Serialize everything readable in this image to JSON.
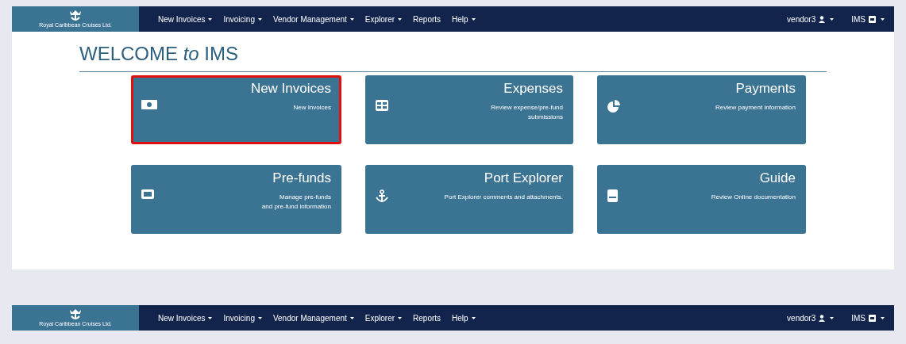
{
  "navbars": [
    {
      "logo_text": "Royal Caribbean Cruises Ltd.",
      "menu": [
        {
          "label": "New Invoices",
          "dropdown": true
        },
        {
          "label": "Invoicing",
          "dropdown": true
        },
        {
          "label": "Vendor Management",
          "dropdown": true
        },
        {
          "label": "Explorer",
          "dropdown": true
        },
        {
          "label": "Reports",
          "dropdown": false
        },
        {
          "label": "Help",
          "dropdown": true
        }
      ],
      "user": "vendor3",
      "app": "IMS"
    },
    {
      "logo_text": "Royal Caribbean Cruises Ltd.",
      "menu": [
        {
          "label": "New Invoices",
          "dropdown": true
        },
        {
          "label": "Invoicing",
          "dropdown": true
        },
        {
          "label": "Vendor Management",
          "dropdown": true
        },
        {
          "label": "Explorer",
          "dropdown": true
        },
        {
          "label": "Reports",
          "dropdown": false
        },
        {
          "label": "Help",
          "dropdown": true
        }
      ],
      "user": "vendor3",
      "app": "IMS"
    }
  ],
  "heading": "WELCOME *to* IMS",
  "tiles": [
    {
      "title": "New Invoices",
      "description": [
        "New Invoices"
      ],
      "selected": true
    },
    {
      "title": "Expenses",
      "description": [
        "Review expense/pre-fund",
        "submissions"
      ],
      "selected": false
    },
    {
      "title": "Payments",
      "description": [
        "Review payment information"
      ],
      "selected": false
    },
    {
      "title": "Pre-funds",
      "description": [
        "Manage pre-funds",
        "and pre-fund information"
      ],
      "selected": false
    },
    {
      "title": "Port Explorer",
      "description": [
        "Port Explorer comments and attachments."
      ],
      "selected": false
    },
    {
      "title": "Guide",
      "description": [
        "Review Online documentation"
      ],
      "selected": false
    }
  ]
}
